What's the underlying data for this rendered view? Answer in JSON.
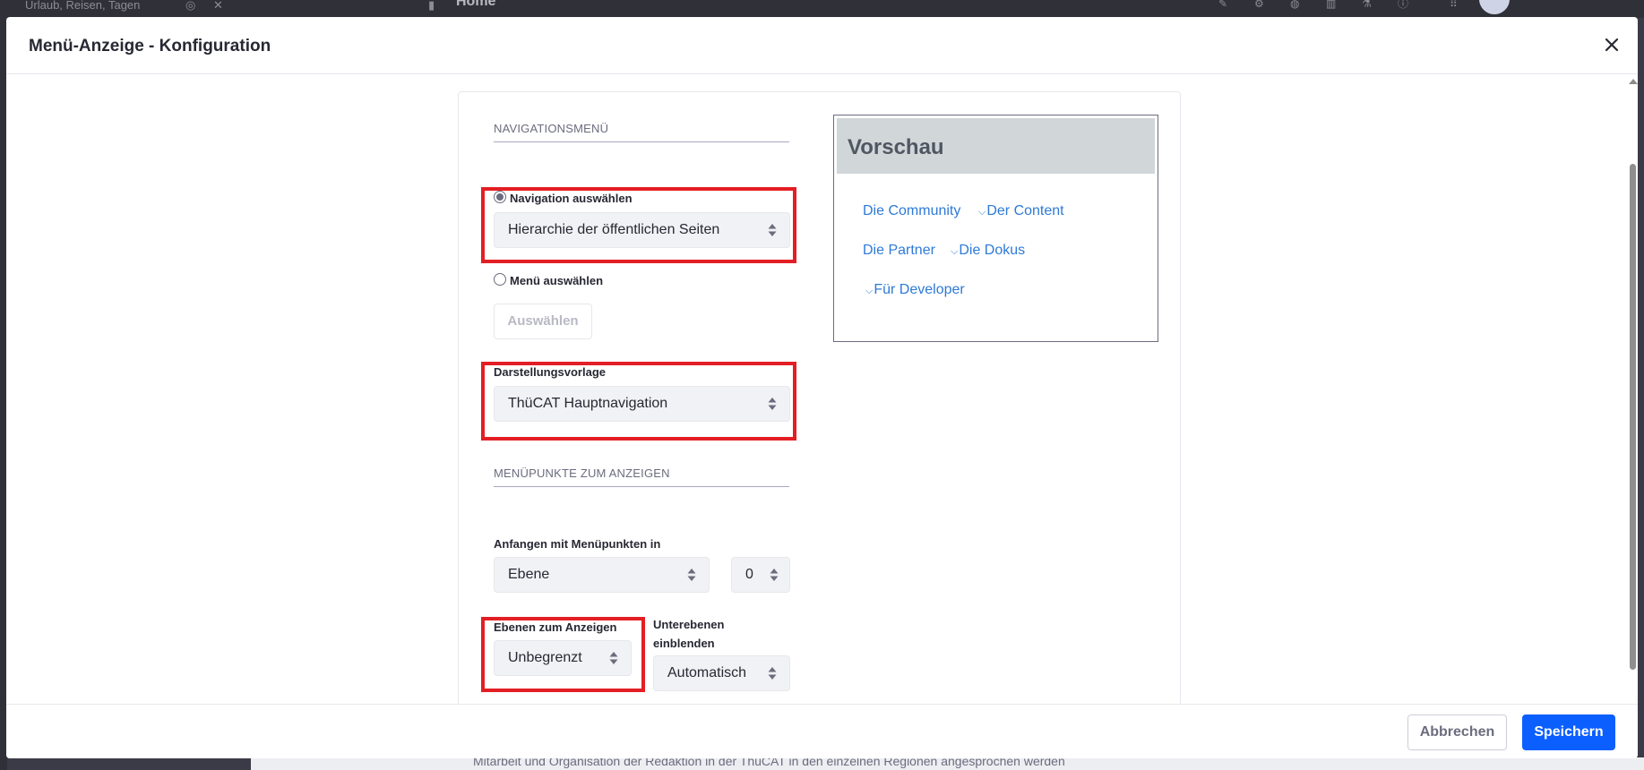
{
  "background": {
    "breadcrumb_text": "Urlaub, Reisen, Tagen",
    "page_title": "Home",
    "bottom_text": "Mitarbeit und Organisation der Redaktion in der ThüCAT in den einzelnen Regionen angesprochen werden"
  },
  "modal": {
    "title": "Menü-Anzeige - Konfiguration",
    "close_icon": "close-icon"
  },
  "navigation": {
    "section_title": "NAVIGATIONSMENÜ",
    "option_navigation_label": "Navigation auswählen",
    "option_navigation_checked": true,
    "navigation_select_value": "Hierarchie der öffentlichen Seiten",
    "option_menu_label": "Menü auswählen",
    "option_menu_checked": false,
    "select_button_label": "Auswählen",
    "template_label": "Darstellungsvorlage",
    "template_select_value": "ThüCAT Hauptnavigation"
  },
  "menu_items": {
    "section_title": "MENÜPUNKTE ZUM ANZEIGEN",
    "start_label": "Anfangen mit Menüpunkten in",
    "start_select_value": "Ebene",
    "start_level_value": "0",
    "levels_label": "Ebenen zum Anzeigen",
    "levels_select_value": "Unbegrenzt",
    "sublevels_label": "Unterebenen einblenden",
    "sublevels_select_value": "Automatisch"
  },
  "preview": {
    "title": "Vorschau",
    "links": [
      {
        "label": "Die Community",
        "has_children": false
      },
      {
        "label": "Der Content",
        "has_children": true
      },
      {
        "label": "Die Partner",
        "has_children": false
      },
      {
        "label": "Die Dokus",
        "has_children": true
      },
      {
        "label": "Für Developer",
        "has_children": true
      }
    ]
  },
  "footer": {
    "cancel_label": "Abbrechen",
    "save_label": "Speichern"
  },
  "colors": {
    "primary": "#0b5fff",
    "link": "#2e7ad6",
    "highlight": "#e31e24",
    "preview_header": "#d1d6d9"
  }
}
